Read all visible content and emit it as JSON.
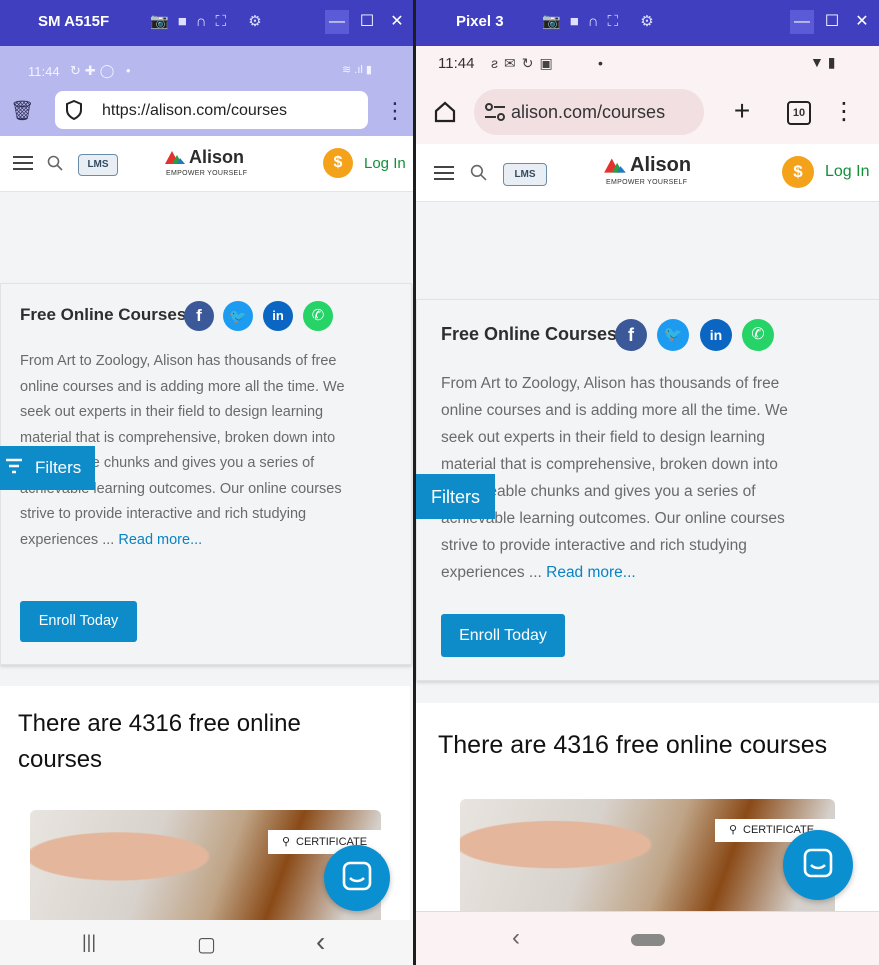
{
  "devices": [
    {
      "name": "SM A515F",
      "status": {
        "time": "11:44",
        "dot": "•"
      },
      "browser": {
        "url": "https://alison.com/courses"
      },
      "site": {
        "lms_label": "LMS",
        "logo": "Alison",
        "tagline": "EMPOWER YOURSELF",
        "coin": "$",
        "login": "Log In"
      },
      "page": {
        "heading": "Free Online Courses",
        "description": "From Art to Zoology, Alison has thousands of free online courses and is adding more all the time. We seek out experts in their field to design learning material that is comprehensive, broken down into manageable chunks and gives you a series of achievable learning outcomes. Our online courses strive to provide interactive and rich studying experiences ...",
        "read_more": "Read more...",
        "enroll": "Enroll Today",
        "filters": "Filters",
        "count_text": "There are 4316 free online courses",
        "certificate": "CERTIFICATE"
      },
      "nav": {
        "recents": "|||",
        "home": "▢",
        "back": "‹"
      }
    },
    {
      "name": "Pixel 3",
      "status": {
        "time": "11:44",
        "dot": "•"
      },
      "browser": {
        "url": "alison.com/courses",
        "tab_count": "10"
      },
      "site": {
        "lms_label": "LMS",
        "logo": "Alison",
        "tagline": "EMPOWER YOURSELF",
        "coin": "$",
        "login": "Log In"
      },
      "page": {
        "heading": "Free Online Courses",
        "description": "From Art to Zoology, Alison has thousands of free online courses and is adding more all the time. We seek out experts in their field to design learning material that is comprehensive, broken down into manageable chunks and gives you a series of achievable learning outcomes. Our online courses strive to provide interactive and rich studying experiences ...",
        "read_more": "Read more...",
        "enroll": "Enroll Today",
        "filters": "Filters",
        "count_text": "There are 4316 free online courses",
        "certificate": "CERTIFICATE"
      },
      "nav": {
        "back": "‹"
      }
    }
  ],
  "colors": {
    "titlebar": "#3f3fbf",
    "accent": "#0e8bc9",
    "login_green": "#138f3a",
    "coin_orange": "#f5a21b"
  }
}
